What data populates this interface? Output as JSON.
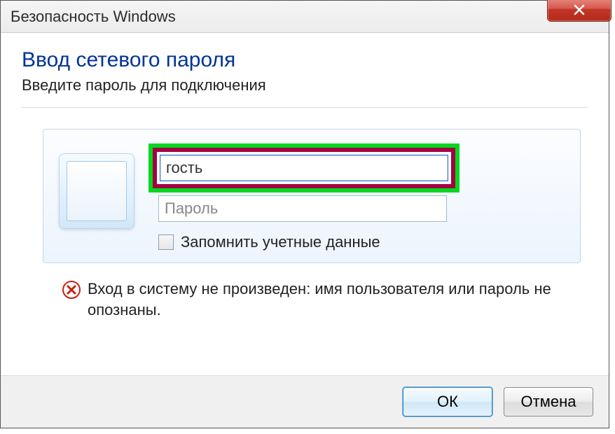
{
  "window": {
    "title": "Безопасность Windows"
  },
  "dialog": {
    "heading": "Ввод сетевого пароля",
    "subheading": "Введите пароль для подключения"
  },
  "credentials": {
    "username_value": "гость",
    "password_placeholder": "Пароль",
    "remember_label": "Запомнить учетные данные"
  },
  "error": {
    "message": "Вход в систему не произведен: имя пользователя или пароль не опознаны."
  },
  "buttons": {
    "ok": "ОК",
    "cancel": "Отмена"
  }
}
